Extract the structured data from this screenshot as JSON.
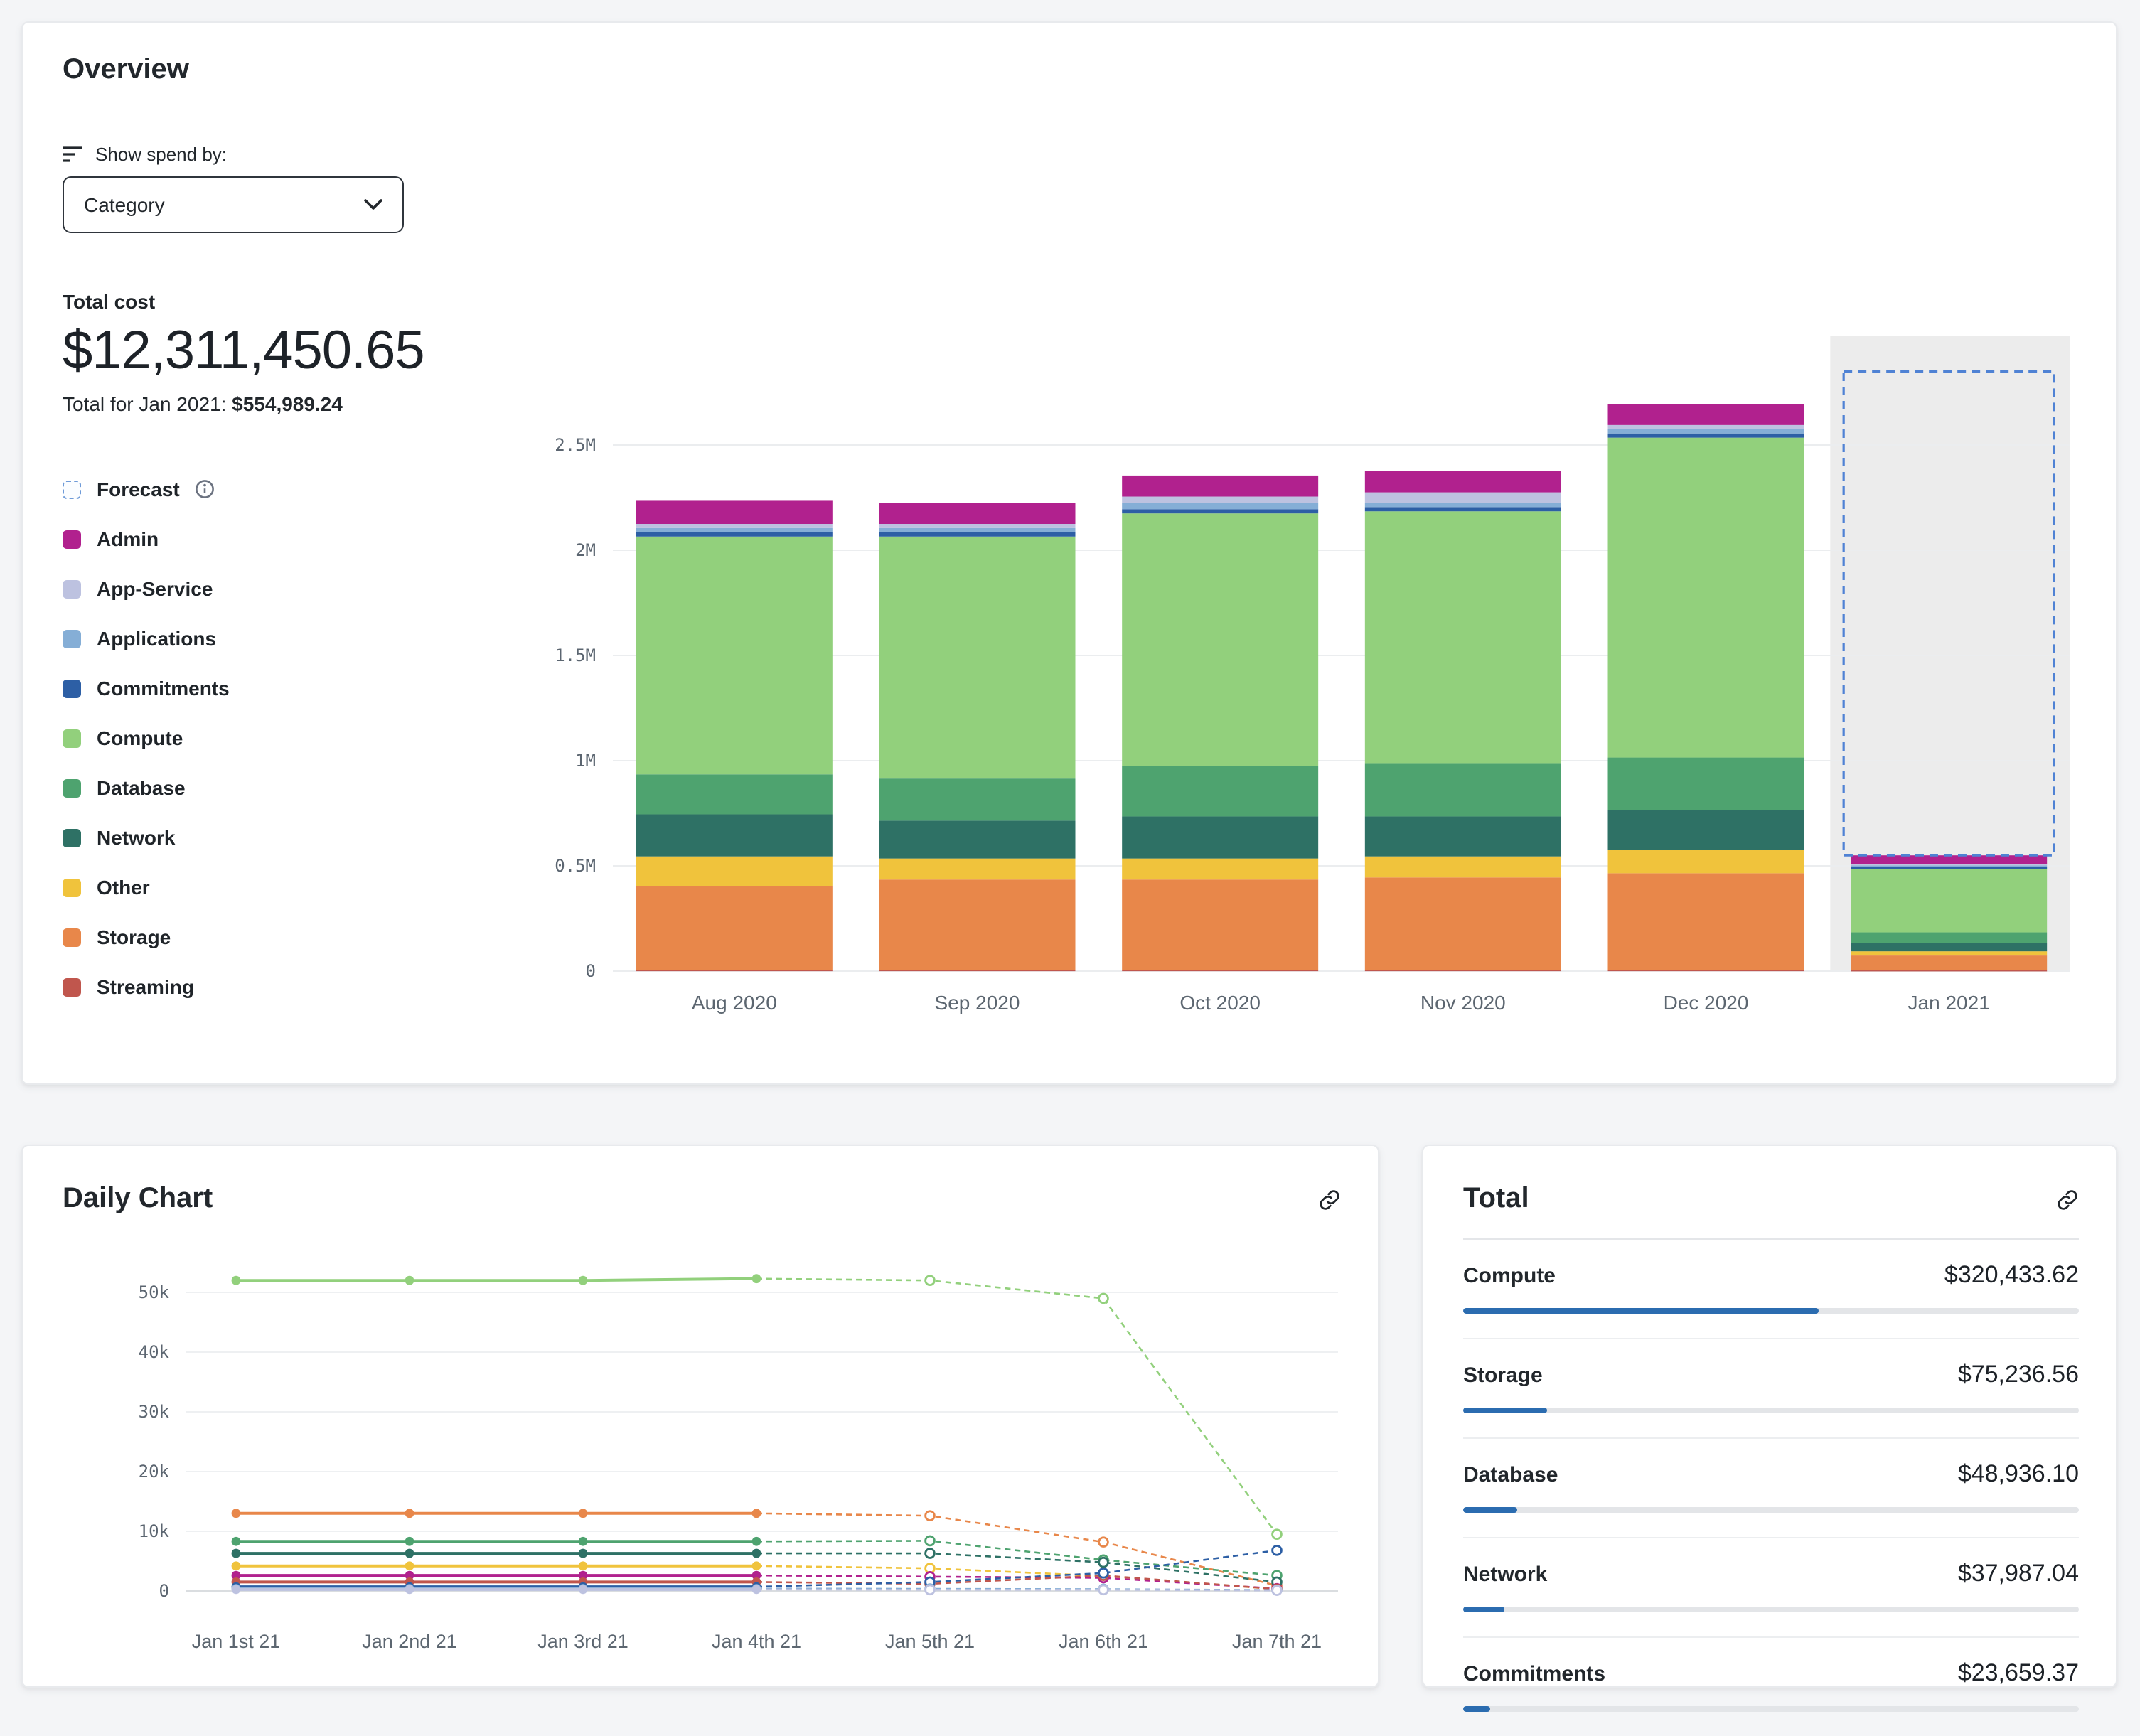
{
  "overview": {
    "title": "Overview",
    "show_spend_by_label": "Show spend by:",
    "group_by_value": "Category",
    "total_cost_label": "Total cost",
    "total_cost": "$12,311,450.65",
    "period_total_prefix": "Total for Jan 2021: ",
    "period_total": "$554,989.24",
    "legend": [
      {
        "label": "Forecast",
        "type": "forecast"
      },
      {
        "label": "Admin",
        "color": "#b1218e"
      },
      {
        "label": "App-Service",
        "color": "#bdc2e0"
      },
      {
        "label": "Applications",
        "color": "#85aed6"
      },
      {
        "label": "Commitments",
        "color": "#2d5fa5"
      },
      {
        "label": "Compute",
        "color": "#92d07c"
      },
      {
        "label": "Database",
        "color": "#4ea36f"
      },
      {
        "label": "Network",
        "color": "#2e7165"
      },
      {
        "label": "Other",
        "color": "#f0c33c"
      },
      {
        "label": "Storage",
        "color": "#e8874a"
      },
      {
        "label": "Streaming",
        "color": "#c0564d"
      }
    ]
  },
  "daily_chart": {
    "title": "Daily Chart"
  },
  "total_panel": {
    "title": "Total",
    "bar_color": "#2b6cb0",
    "rows": [
      {
        "label": "Compute",
        "amount": "$320,433.62",
        "percent": 57.7
      },
      {
        "label": "Storage",
        "amount": "$75,236.56",
        "percent": 13.6
      },
      {
        "label": "Database",
        "amount": "$48,936.10",
        "percent": 8.8
      },
      {
        "label": "Network",
        "amount": "$37,987.04",
        "percent": 6.8
      },
      {
        "label": "Commitments",
        "amount": "$23,659.37",
        "percent": 4.3
      }
    ]
  },
  "chart_data": [
    {
      "type": "bar",
      "stacked": true,
      "categories": [
        "Aug 2020",
        "Sep 2020",
        "Oct 2020",
        "Nov 2020",
        "Dec 2020",
        "Jan 2021"
      ],
      "unit": "millions USD",
      "ylim": [
        0,
        2.9
      ],
      "yticks": [
        0,
        0.5,
        1,
        1.5,
        2,
        2.5
      ],
      "ytick_labels": [
        "0",
        "0.5M",
        "1M",
        "1.5M",
        "2M",
        "2.5M"
      ],
      "series": [
        {
          "name": "Streaming",
          "color": "#c0564d",
          "values": [
            0.005,
            0.005,
            0.005,
            0.005,
            0.005,
            0.004
          ]
        },
        {
          "name": "Storage",
          "color": "#e8874a",
          "values": [
            0.4,
            0.43,
            0.43,
            0.44,
            0.46,
            0.07
          ]
        },
        {
          "name": "Other",
          "color": "#f0c33c",
          "values": [
            0.14,
            0.1,
            0.1,
            0.1,
            0.11,
            0.02
          ]
        },
        {
          "name": "Network",
          "color": "#2e7165",
          "values": [
            0.2,
            0.18,
            0.2,
            0.19,
            0.19,
            0.04
          ]
        },
        {
          "name": "Database",
          "color": "#4ea36f",
          "values": [
            0.19,
            0.2,
            0.24,
            0.25,
            0.25,
            0.05
          ]
        },
        {
          "name": "Compute",
          "color": "#92d07c",
          "values": [
            1.13,
            1.15,
            1.2,
            1.2,
            1.52,
            0.3
          ]
        },
        {
          "name": "Commitments",
          "color": "#2d5fa5",
          "values": [
            0.02,
            0.02,
            0.02,
            0.02,
            0.02,
            0.01
          ]
        },
        {
          "name": "Applications",
          "color": "#85aed6",
          "values": [
            0.02,
            0.02,
            0.03,
            0.02,
            0.02,
            0.008
          ]
        },
        {
          "name": "App-Service",
          "color": "#bdc2e0",
          "values": [
            0.02,
            0.02,
            0.03,
            0.05,
            0.02,
            0.008
          ]
        },
        {
          "name": "Admin",
          "color": "#b1218e",
          "values": [
            0.11,
            0.1,
            0.1,
            0.1,
            0.1,
            0.04
          ]
        }
      ],
      "forecast": {
        "category": "Jan 2021",
        "total": 2.85
      }
    },
    {
      "type": "line",
      "x": [
        "Jan 1st 21",
        "Jan 2nd 21",
        "Jan 3rd 21",
        "Jan 4th 21",
        "Jan 5th 21",
        "Jan 6th 21",
        "Jan 7th 21"
      ],
      "ylim": [
        0,
        55000
      ],
      "yticks": [
        0,
        10000,
        20000,
        30000,
        40000,
        50000
      ],
      "ytick_labels": [
        "0",
        "10k",
        "20k",
        "30k",
        "40k",
        "50k"
      ],
      "solid_points": 4,
      "series": [
        {
          "name": "Compute",
          "color": "#92d07c",
          "values": [
            52000,
            52000,
            52000,
            52300,
            52000,
            49000,
            9500
          ]
        },
        {
          "name": "Storage",
          "color": "#e8874a",
          "values": [
            13000,
            13000,
            13000,
            13000,
            12600,
            8200,
            900
          ]
        },
        {
          "name": "Database",
          "color": "#4ea36f",
          "values": [
            8300,
            8300,
            8300,
            8300,
            8400,
            5200,
            2600
          ]
        },
        {
          "name": "Network",
          "color": "#2e7165",
          "values": [
            6300,
            6300,
            6300,
            6300,
            6300,
            4800,
            1500
          ]
        },
        {
          "name": "Other",
          "color": "#f0c33c",
          "values": [
            4200,
            4200,
            4200,
            4200,
            3800,
            2500,
            300
          ]
        },
        {
          "name": "Admin",
          "color": "#b1218e",
          "values": [
            2600,
            2600,
            2600,
            2600,
            2400,
            2200,
            400
          ]
        },
        {
          "name": "Streaming",
          "color": "#c0564d",
          "values": [
            1500,
            1500,
            1500,
            1500,
            1200,
            2600,
            300
          ]
        },
        {
          "name": "Commitments",
          "color": "#2d5fa5",
          "values": [
            700,
            700,
            700,
            700,
            1500,
            3000,
            6800
          ]
        },
        {
          "name": "Applications",
          "color": "#85aed6",
          "values": [
            400,
            400,
            400,
            400,
            350,
            300,
            150
          ]
        },
        {
          "name": "App-Service",
          "color": "#bdc2e0",
          "values": [
            250,
            250,
            250,
            250,
            200,
            200,
            100
          ]
        }
      ]
    }
  ]
}
